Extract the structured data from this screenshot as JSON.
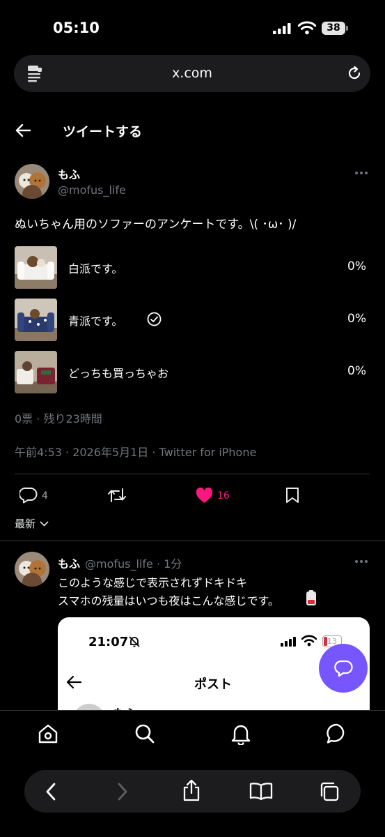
{
  "status_bar": {
    "time": "05:10",
    "battery": "38"
  },
  "browser": {
    "url": "x.com"
  },
  "header": {
    "title": "ツイートする"
  },
  "tweet": {
    "display_name": "もふ",
    "handle": "@mofus_life",
    "text": "ぬいちゃん用のソファーのアンケートです。\\( ･ω･ )/",
    "poll": {
      "options": [
        {
          "label": "白派です。",
          "percent": "0%",
          "selected": false
        },
        {
          "label": "青派です。",
          "percent": "0%",
          "selected": true
        },
        {
          "label": "どっちも買っちゃお",
          "percent": "0%",
          "selected": false
        }
      ],
      "summary": "0票 · 残り23時間"
    },
    "meta": "午前4:53 · 2026年5月1日 · Twitter for iPhone",
    "actions": {
      "replies": "4",
      "likes": "16"
    }
  },
  "sort": {
    "label": "最新"
  },
  "reply": {
    "display_name": "もふ",
    "handle": "@mofus_life · 1分",
    "line1": "このような感じで表示されずドキドキ",
    "line2": "スマホの残量はいつも夜はこんな感じです。",
    "embed": {
      "time": "21:07",
      "battery": "13",
      "title": "ポスト",
      "partial_name": "もふ"
    }
  },
  "colors": {
    "like": "#f91880",
    "fab": "#7856ff",
    "background": "#000000",
    "muted": "#71767b"
  }
}
